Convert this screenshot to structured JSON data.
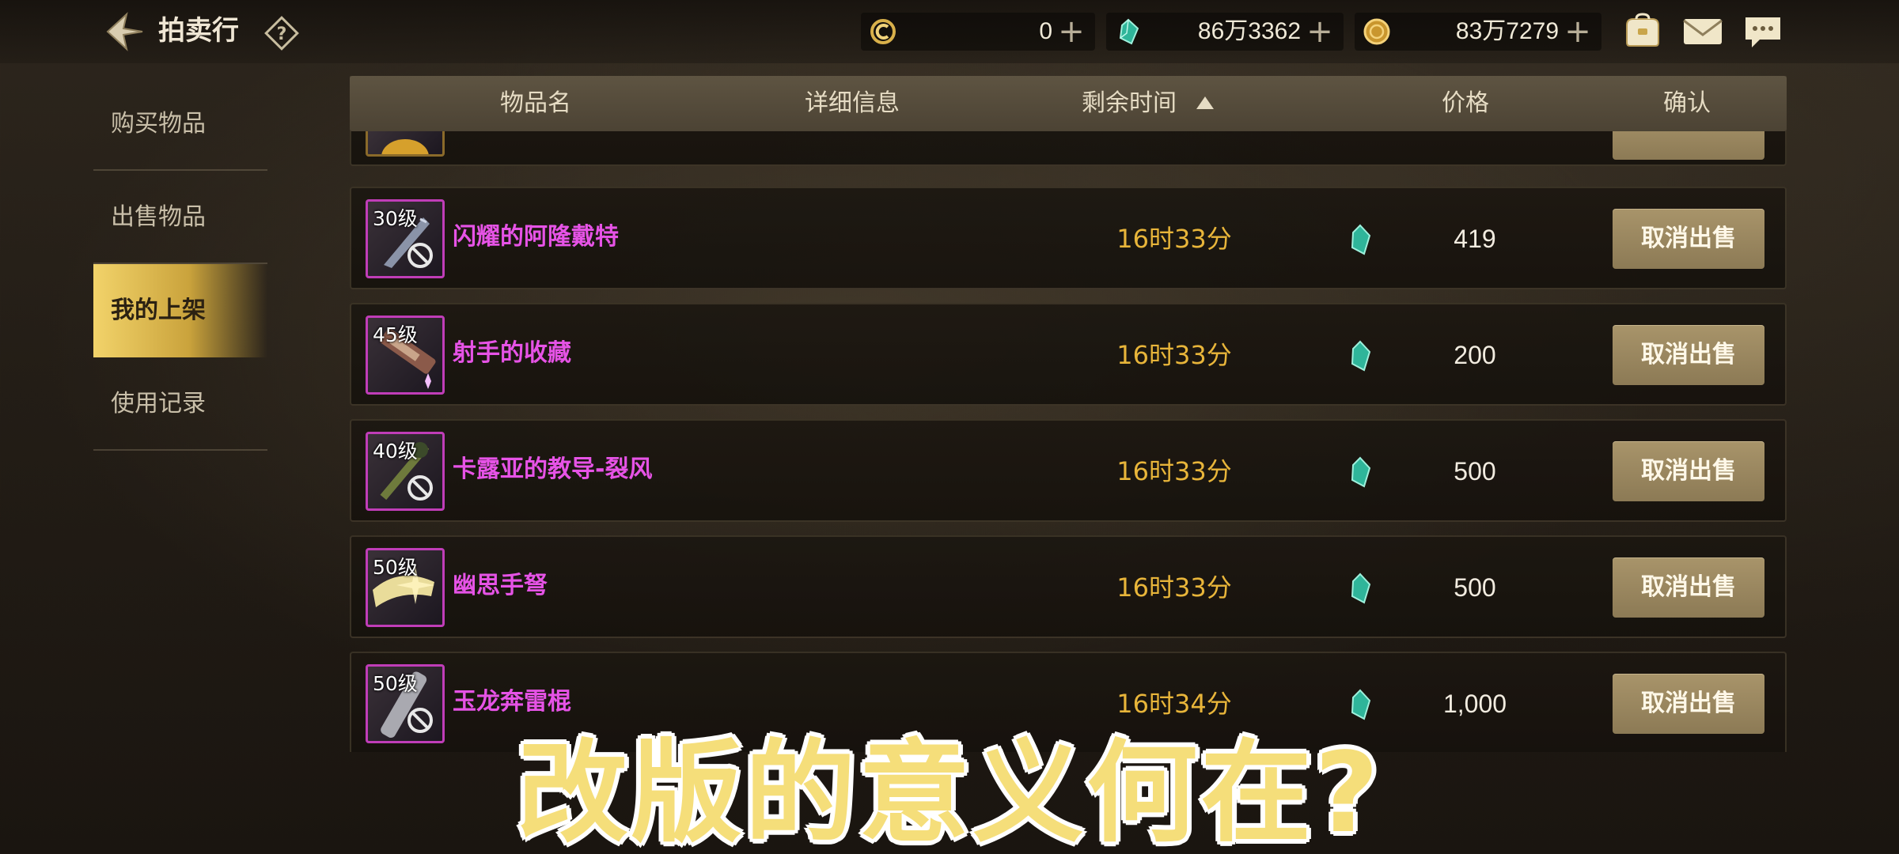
{
  "header": {
    "title": "拍卖行",
    "back_icon": "back-arrow-icon",
    "help_icon": "help-question-icon"
  },
  "currencies": [
    {
      "icon": "c-coin-icon",
      "value": "0"
    },
    {
      "icon": "green-gem-icon",
      "value": "86万3362"
    },
    {
      "icon": "gold-coin-icon",
      "value": "83万7279"
    }
  ],
  "plus_glyph": "+",
  "top_icons": [
    "bag-icon",
    "mail-icon",
    "chat-icon"
  ],
  "sidebar": {
    "items": [
      {
        "label": "购买物品",
        "active": false
      },
      {
        "label": "出售物品",
        "active": false
      },
      {
        "label": "我的上架",
        "active": true
      },
      {
        "label": "使用记录",
        "active": false
      }
    ]
  },
  "table": {
    "columns": [
      "物品名",
      "详细信息",
      "剩余时间",
      "价格",
      "确认"
    ],
    "sort_column": "剩余时间",
    "sort_direction": "ascending",
    "rows": [
      {
        "level": "30级",
        "name": "闪耀的阿隆戴特",
        "time": "16时33分",
        "price": "419",
        "action": "取消出售",
        "art": "blade"
      },
      {
        "level": "45级",
        "name": "射手的收藏",
        "time": "16时33分",
        "price": "200",
        "action": "取消出售",
        "art": "cannon"
      },
      {
        "level": "40级",
        "name": "卡露亚的教导-裂风",
        "time": "16时33分",
        "price": "500",
        "action": "取消出售",
        "art": "staff"
      },
      {
        "level": "50级",
        "name": "幽思手弩",
        "time": "16时33分",
        "price": "500",
        "action": "取消出售",
        "art": "crossbow"
      },
      {
        "level": "50级",
        "name": "玉龙奔雷棍",
        "time": "16时34分",
        "price": "1,000",
        "action": "取消出售",
        "art": "rod"
      }
    ]
  },
  "overlay_caption": "改版的意义何在?",
  "colors": {
    "item_name": "#e653e6",
    "time": "#e8b53a",
    "caption": "#f5de7a",
    "active_tab": "#f2d36a"
  }
}
